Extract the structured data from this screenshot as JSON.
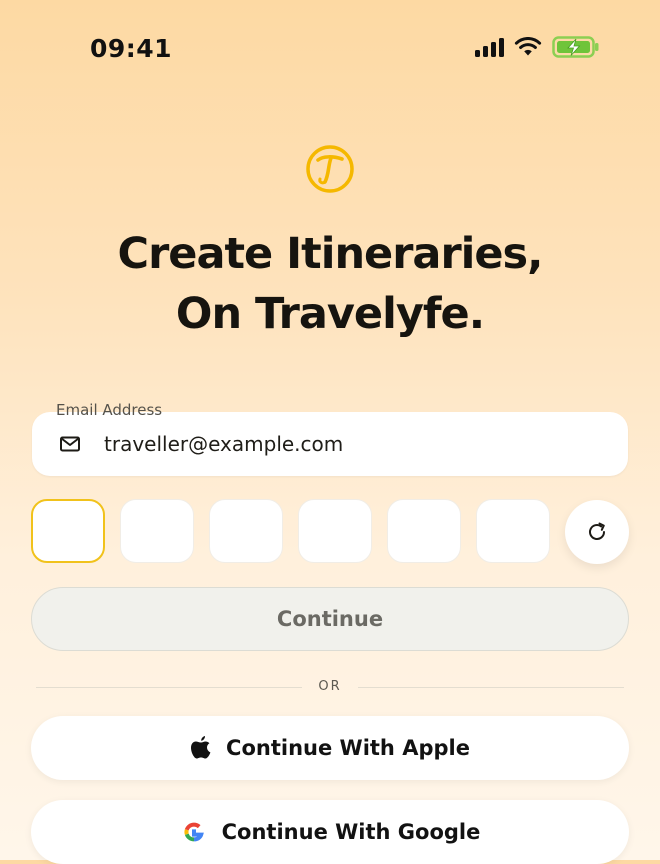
{
  "status_bar": {
    "time": "09:41",
    "icons": [
      "signal-icon",
      "wifi-icon",
      "battery-charging-icon"
    ]
  },
  "brand": {
    "logo_icon": "travelyfe-logo-icon",
    "accent_color": "#f5b800"
  },
  "headline": {
    "line1": "Create Itineraries,",
    "line2": "On Travelyfe."
  },
  "email": {
    "label": "Email Address",
    "value": "traveller@example.com",
    "icon": "mail-icon"
  },
  "otp": {
    "digits": [
      "",
      "",
      "",
      "",
      "",
      ""
    ],
    "active_index": 0,
    "refresh_icon": "refresh-icon"
  },
  "continue": {
    "label": "Continue"
  },
  "divider": {
    "label": "OR"
  },
  "social": {
    "apple_label": "Continue With Apple",
    "google_label": "Continue With Google"
  }
}
